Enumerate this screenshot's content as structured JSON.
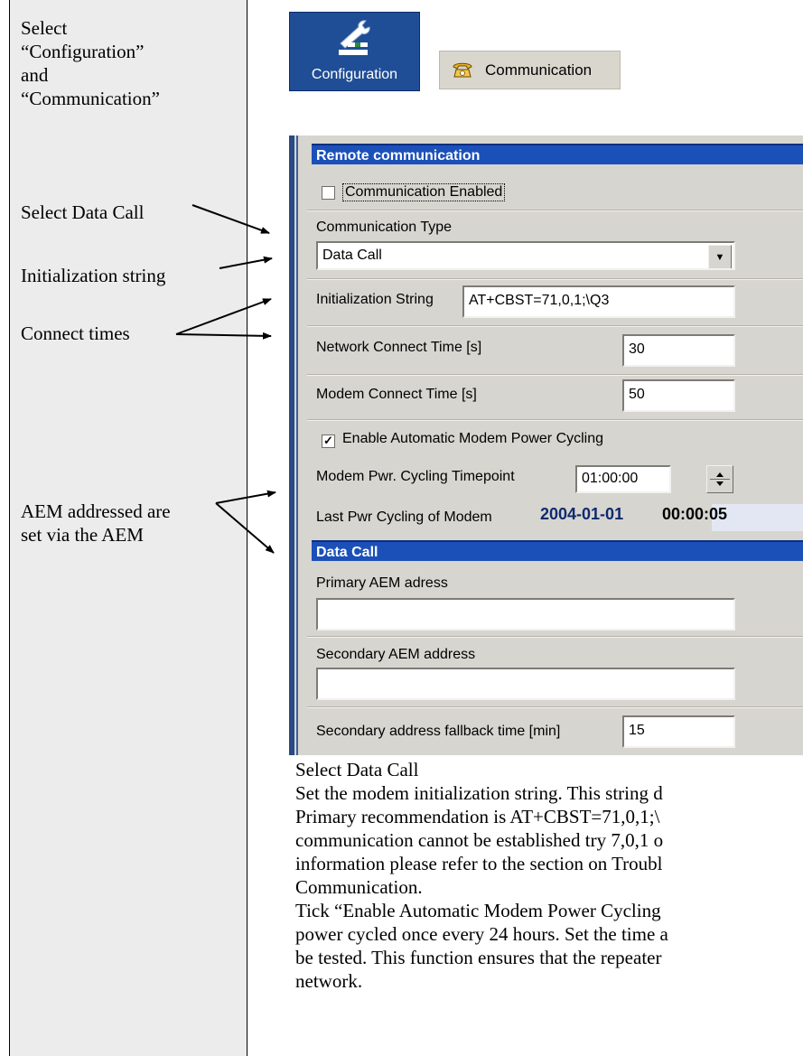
{
  "sidebar": {
    "notes": [
      [
        "Select",
        "“Configuration”",
        "and",
        "“Communication”"
      ],
      [
        "Select Data Call"
      ],
      [
        "Initialization string"
      ],
      [
        "Connect times"
      ],
      [
        "AEM addressed are",
        "set via the AEM"
      ]
    ]
  },
  "toolbar": {
    "configuration_label": "Configuration",
    "communication_label": "Communication"
  },
  "dialog": {
    "remote_section_title": "Remote communication",
    "comm_enabled_label": "Communication Enabled",
    "comm_enabled_checked": false,
    "comm_type_label": "Communication Type",
    "comm_type_value": "Data Call",
    "init_string_label": "Initialization String",
    "init_string_value": "AT+CBST=71,0,1;\\Q3",
    "network_connect_label": "Network Connect Time [s]",
    "network_connect_value": "30",
    "modem_connect_label": "Modem Connect Time [s]",
    "modem_connect_value": "50",
    "power_cycling_label": "Enable Automatic Modem Power Cycling",
    "power_cycling_checked": true,
    "timepoint_label": "Modem Pwr. Cycling Timepoint",
    "timepoint_value": "01:00:00",
    "last_cycle_label": "Last Pwr Cycling of Modem",
    "last_cycle_date": "2004-01-01",
    "last_cycle_time": "00:00:05",
    "data_call_section_title": "Data Call",
    "primary_label": "Primary AEM adress",
    "primary_value": "",
    "secondary_label": "Secondary AEM address",
    "secondary_value": "",
    "fallback_label": "Secondary address fallback time [min]",
    "fallback_value": "15"
  },
  "body_text": [
    "Select Data Call",
    "Set the modem initialization string. This string d",
    "Primary recommendation is AT+CBST=71,0,1;\\",
    "communication cannot be established try 7,0,1 o",
    "information please refer to the section on Troubl",
    "Communication.",
    "Tick “Enable Automatic Modem Power Cycling",
    "power cycled once every 24 hours. Set the time a",
    "be tested. This function ensures that the repeater",
    "network."
  ]
}
